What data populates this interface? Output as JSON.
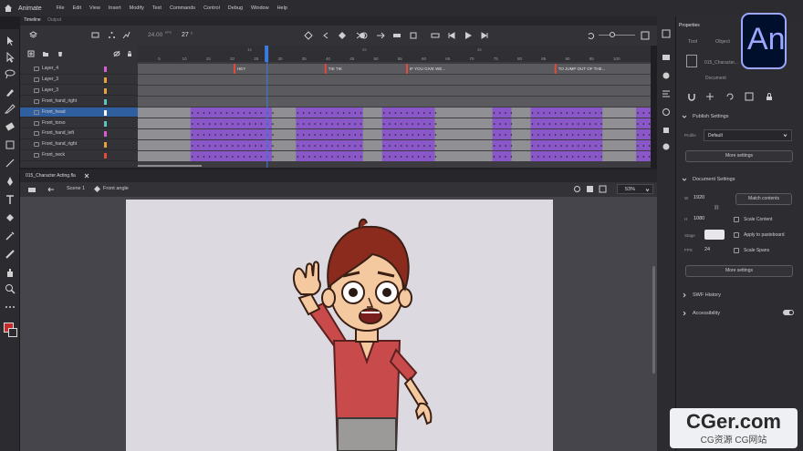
{
  "menubar": {
    "app_name": "Animate",
    "items": [
      "File",
      "Edit",
      "View",
      "Insert",
      "Modify",
      "Text",
      "Commands",
      "Control",
      "Debug",
      "Window",
      "Help"
    ]
  },
  "timeline": {
    "tabs": [
      "Timeline",
      "Output"
    ],
    "fps": "24.00",
    "fps_unit": "FPS",
    "current_frame": "27",
    "frame_unit": "F",
    "ruler_major": [
      "1s",
      "2s",
      "3s"
    ],
    "ruler": [
      "5",
      "10",
      "15",
      "20",
      "25",
      "30",
      "35",
      "40",
      "45",
      "50",
      "55",
      "60",
      "65",
      "70",
      "75",
      "80",
      "85",
      "90",
      "95",
      "100"
    ],
    "frame_labels": [
      "HEY",
      "TIK TIK",
      "IF YOU GIVE WE...",
      "TO JUMP OUT OF THE..."
    ],
    "layers": [
      {
        "name": "Layer_4",
        "color": "#d85ad4",
        "type": "folder"
      },
      {
        "name": "Layer_3",
        "color": "#e6a23c",
        "type": "layer"
      },
      {
        "name": "Layer_3",
        "color": "#e6a23c",
        "type": "layer"
      },
      {
        "name": "Front_hand_right",
        "color": "#5fc4c8",
        "type": "layer"
      },
      {
        "name": "Front_head",
        "color": "#ffffff",
        "type": "layer",
        "selected": true
      },
      {
        "name": "Front_torso",
        "color": "#5fc4c8",
        "type": "layer"
      },
      {
        "name": "Front_hand_left",
        "color": "#d85ad4",
        "type": "layer"
      },
      {
        "name": "Front_hand_right",
        "color": "#e6a23c",
        "type": "layer"
      },
      {
        "name": "Front_neck",
        "color": "#e04b3c",
        "type": "layer"
      }
    ]
  },
  "doc": {
    "filename": "015_Character Acting.fla",
    "scene": "Scene 1",
    "symbol": "Front angle",
    "zoom": "53%"
  },
  "properties": {
    "title": "Properties",
    "tabs": [
      "Tool",
      "Object"
    ],
    "object_name": "015_Character...",
    "object_type": "Document",
    "publish_settings_label": "Publish Settings",
    "profile_label": "Profile",
    "profile_value": "Default",
    "more_settings": "More settings",
    "document_settings_label": "Document Settings",
    "w_label": "W",
    "w_value": "1920",
    "h_label": "H",
    "h_value": "1080",
    "link_glyph": "⛓",
    "match_contents": "Match contents",
    "scale_content": "Scale Content",
    "stage_label": "Stage",
    "apply_pasteboard": "Apply to pasteboard",
    "fps_label": "FPS",
    "fps_value": "24",
    "scale_spans": "Scale Spans",
    "more_settings2": "More settings",
    "swf_history": "SWF History",
    "accessibility": "Accessibility"
  },
  "branding": {
    "an_logo": "An",
    "watermark_main": "CGer.com",
    "watermark_sub": "CG资源 CG网站"
  },
  "colors": {
    "accent_blue": "#3a7be0",
    "selected_layer": "#2f5f9e",
    "tween_purple": "#8a57c9",
    "stage_bg": "#dcdae0",
    "shirt": "#c94a4a",
    "hair": "#8b2b1e",
    "skin": "#f5c9a0",
    "pants": "#9c9a98"
  }
}
